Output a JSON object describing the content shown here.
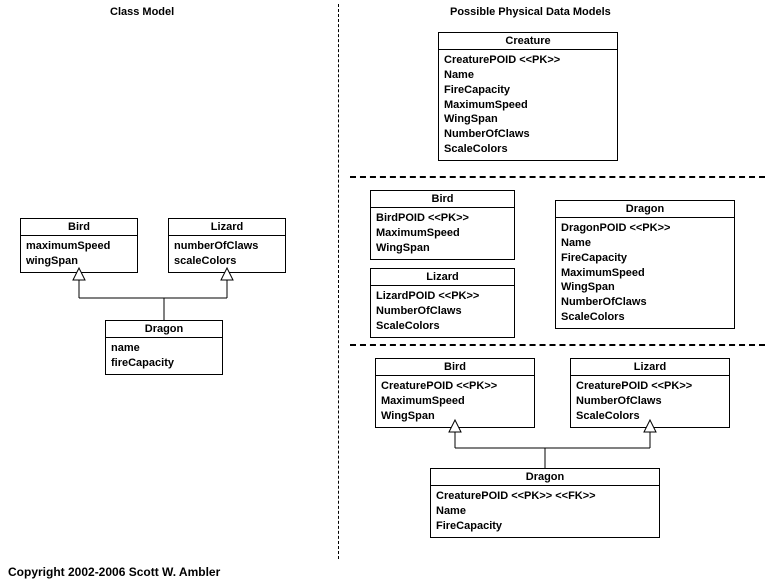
{
  "headings": {
    "left": "Class Model",
    "right": "Possible Physical Data Models"
  },
  "classModel": {
    "bird": {
      "title": "Bird",
      "attrs": [
        "maximumSpeed",
        "wingSpan"
      ]
    },
    "lizard": {
      "title": "Lizard",
      "attrs": [
        "numberOfClaws",
        "scaleColors"
      ]
    },
    "dragon": {
      "title": "Dragon",
      "attrs": [
        "name",
        "fireCapacity"
      ]
    }
  },
  "pdm1": {
    "creature": {
      "title": "Creature",
      "attrs": [
        "CreaturePOID <<PK>>",
        "Name",
        "FireCapacity",
        "MaximumSpeed",
        "WingSpan",
        "NumberOfClaws",
        "ScaleColors"
      ]
    }
  },
  "pdm2": {
    "bird": {
      "title": "Bird",
      "attrs": [
        "BirdPOID <<PK>>",
        "MaximumSpeed",
        "WingSpan"
      ]
    },
    "lizard": {
      "title": "Lizard",
      "attrs": [
        "LizardPOID <<PK>>",
        "NumberOfClaws",
        "ScaleColors"
      ]
    },
    "dragon": {
      "title": "Dragon",
      "attrs": [
        "DragonPOID <<PK>>",
        "Name",
        "FireCapacity",
        "MaximumSpeed",
        "WingSpan",
        "NumberOfClaws",
        "ScaleColors"
      ]
    }
  },
  "pdm3": {
    "bird": {
      "title": "Bird",
      "attrs": [
        "CreaturePOID <<PK>>",
        "MaximumSpeed",
        "WingSpan"
      ]
    },
    "lizard": {
      "title": "Lizard",
      "attrs": [
        "CreaturePOID <<PK>>",
        "NumberOfClaws",
        "ScaleColors"
      ]
    },
    "dragon": {
      "title": "Dragon",
      "attrs": [
        "CreaturePOID <<PK>> <<FK>>",
        "Name",
        "FireCapacity"
      ]
    }
  },
  "copyright": "Copyright 2002-2006 Scott W. Ambler"
}
